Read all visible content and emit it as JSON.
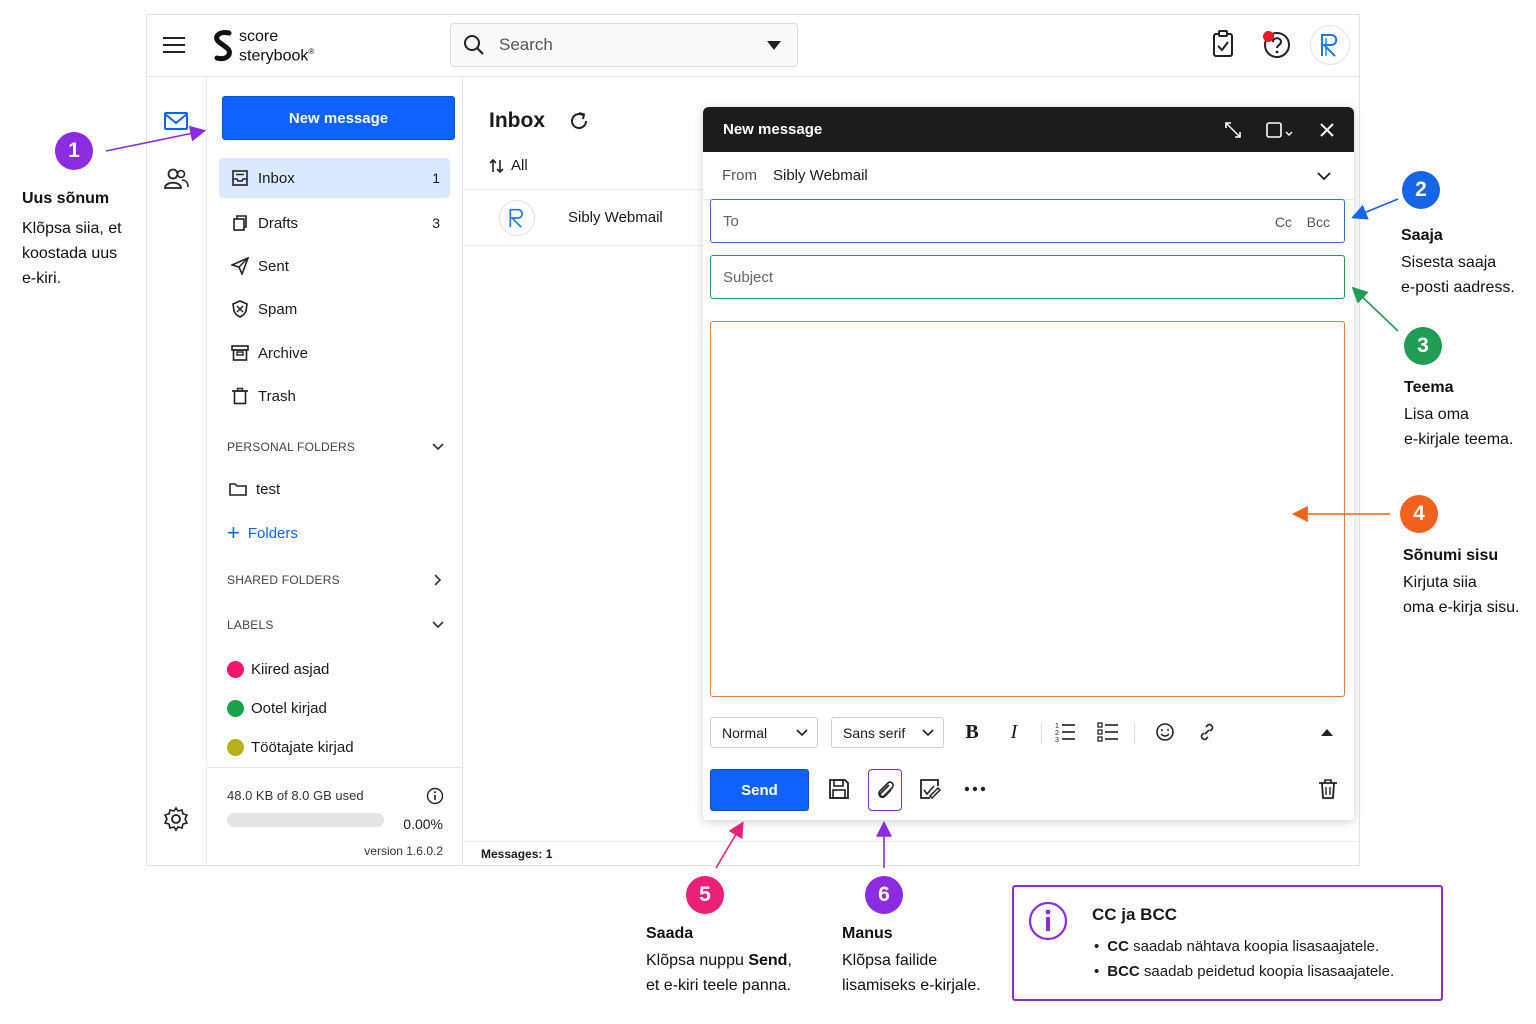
{
  "header": {
    "logo_line1": "score",
    "logo_line2": "sterybook",
    "logo_mark": "®",
    "search_placeholder": "Search"
  },
  "sidebar": {
    "new_message": "New message",
    "items": [
      {
        "label": "Inbox",
        "count": "1"
      },
      {
        "label": "Drafts",
        "count": "3"
      },
      {
        "label": "Sent",
        "count": ""
      },
      {
        "label": "Spam",
        "count": ""
      },
      {
        "label": "Archive",
        "count": ""
      },
      {
        "label": "Trash",
        "count": ""
      }
    ],
    "personal_folders": "PERSONAL FOLDERS",
    "test_folder": "test",
    "add_folders": "Folders",
    "shared_folders": "SHARED FOLDERS",
    "labels_head": "LABELS",
    "labels": [
      {
        "name": "Kiired asjad",
        "color": "#f0186d"
      },
      {
        "name": "Ootel kirjad",
        "color": "#1aa34a"
      },
      {
        "name": "Töötajate kirjad",
        "color": "#b5b11a"
      }
    ],
    "storage_used": "48.0 KB of 8.0 GB used",
    "storage_pct": "0.00%",
    "storage_fraction": 0.0,
    "version": "version 1.6.0.2"
  },
  "list": {
    "title": "Inbox",
    "sort_label": "All",
    "rows": [
      {
        "sender": "Sibly Webmail"
      }
    ],
    "messages_count": "Messages: 1"
  },
  "compose": {
    "title": "New message",
    "from_label": "From",
    "from_value": "Sibly Webmail",
    "to_placeholder": "To",
    "cc": "Cc",
    "bcc": "Bcc",
    "subject_placeholder": "Subject",
    "format_style": "Normal",
    "font": "Sans serif",
    "bold": "B",
    "italic": "I",
    "send": "Send"
  },
  "annotations": {
    "a1": {
      "num": "1",
      "title": "Uus sõnum",
      "lines": [
        "Klõpsa siia, et",
        "koostada uus",
        "e-kiri."
      ],
      "color": "#8b2be2"
    },
    "a2": {
      "num": "2",
      "title": "Saaja",
      "lines": [
        "Sisesta saaja",
        "e-posti aadress."
      ],
      "color": "#1565e6"
    },
    "a3": {
      "num": "3",
      "title": "Teema",
      "lines": [
        "Lisa oma",
        "e-kirjale teema."
      ],
      "color": "#1f9d55"
    },
    "a4": {
      "num": "4",
      "title": "Sõnumi sisu",
      "lines": [
        "Kirjuta siia",
        "oma e-kirja sisu."
      ],
      "color": "#f0621e"
    },
    "a5": {
      "num": "5",
      "title": "Saada",
      "line1_pre": "Klõpsa nuppu ",
      "line1_bold": "Send",
      "line1_post": ",",
      "line2": "et e-kiri teele panna.",
      "color": "#ea1f78"
    },
    "a6": {
      "num": "6",
      "title": "Manus",
      "lines": [
        "Klõpsa failide",
        "lisamiseks e-kirjale."
      ],
      "color": "#8b2be2"
    }
  },
  "info_box": {
    "title": "CC ja BCC",
    "items": [
      {
        "bold": "CC",
        "rest": " saadab nähtava koopia lisasaajatele."
      },
      {
        "bold": "BCC",
        "rest": " saadab peidetud koopia lisasaajatele."
      }
    ]
  }
}
